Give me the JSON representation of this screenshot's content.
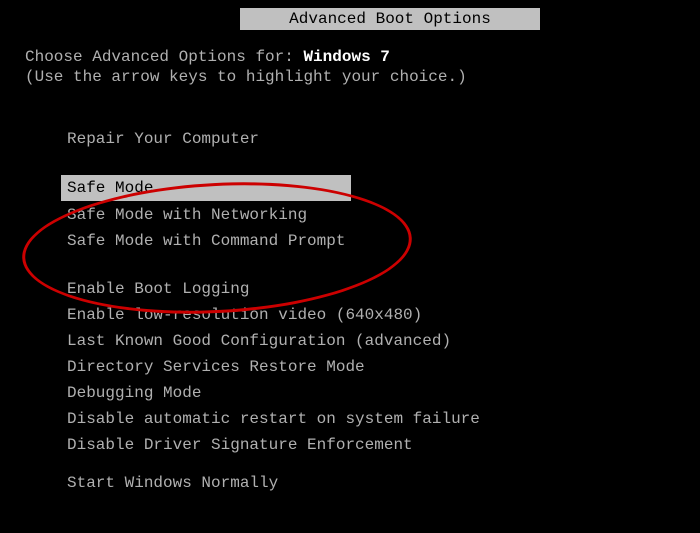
{
  "title": "Advanced Boot Options",
  "header": {
    "prefix": "Choose Advanced Options for: ",
    "os": "Windows 7",
    "hint": "(Use the arrow keys to highlight your choice.)"
  },
  "menu": {
    "group1": [
      {
        "label": "Repair Your Computer"
      }
    ],
    "group2": [
      {
        "label": "Safe Mode",
        "selected": true
      },
      {
        "label": "Safe Mode with Networking"
      },
      {
        "label": "Safe Mode with Command Prompt"
      }
    ],
    "group3": [
      {
        "label": "Enable Boot Logging"
      },
      {
        "label": "Enable low-resolution video (640x480)"
      },
      {
        "label": "Last Known Good Configuration (advanced)"
      },
      {
        "label": "Directory Services Restore Mode"
      },
      {
        "label": "Debugging Mode"
      },
      {
        "label": "Disable automatic restart on system failure"
      },
      {
        "label": "Disable Driver Signature Enforcement"
      }
    ],
    "group4": [
      {
        "label": "Start Windows Normally"
      }
    ]
  }
}
